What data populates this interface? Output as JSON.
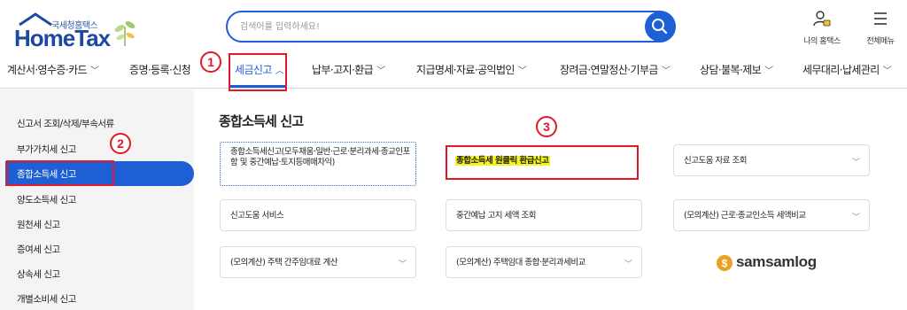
{
  "brand": {
    "sub": "국세청홈택스",
    "main": "HomeTax"
  },
  "search": {
    "placeholder": "검색어를 입력하세요!"
  },
  "header_icons": [
    {
      "label": "나의 홈택스",
      "icon": "user-lock-icon"
    },
    {
      "label": "전체메뉴",
      "icon": "menu-icon"
    }
  ],
  "topnav": [
    {
      "label": "계산서·영수증·카드"
    },
    {
      "label": "증명·등록·신청"
    },
    {
      "label": "세금신고"
    },
    {
      "label": "납부·고지·환급"
    },
    {
      "label": "지급명세·자료·공익법인"
    },
    {
      "label": "장려금·연말정산·기부금"
    },
    {
      "label": "상담·불복·제보"
    },
    {
      "label": "세무대리·납세관리"
    }
  ],
  "sidebar": [
    {
      "label": "신고서 조회/삭제/부속서류"
    },
    {
      "label": "부가가치세 신고"
    },
    {
      "label": "종합소득세 신고"
    },
    {
      "label": "양도소득세 신고"
    },
    {
      "label": "원천세 신고"
    },
    {
      "label": "증여세 신고"
    },
    {
      "label": "상속세 신고"
    },
    {
      "label": "개별소비세 신고"
    }
  ],
  "main": {
    "title": "종합소득세 신고",
    "cards": [
      {
        "label": "종합소득세신고(모두채움·일반·근로·분리과세·종교인포함 및 중간예납·토지등매매차익)"
      },
      {
        "label": "종합소득세 원클릭 환급신고"
      },
      {
        "label": "신고도움 자료 조회"
      },
      {
        "label": "신고도움 서비스"
      },
      {
        "label": "중간예납 고지 세액 조회"
      },
      {
        "label": "(모의계산) 근로·종교인소득 세액비교"
      },
      {
        "label": "(모의계산) 주택 간주임대료 계산"
      },
      {
        "label": "(모의계산) 주택임대 종합·분리과세비교"
      }
    ]
  },
  "annotations": [
    "1",
    "2",
    "3"
  ],
  "watermark": "samsamlog",
  "colors": {
    "accent": "#1e5fd6",
    "annotation": "#e0182a",
    "highlight": "#f5f51c"
  }
}
